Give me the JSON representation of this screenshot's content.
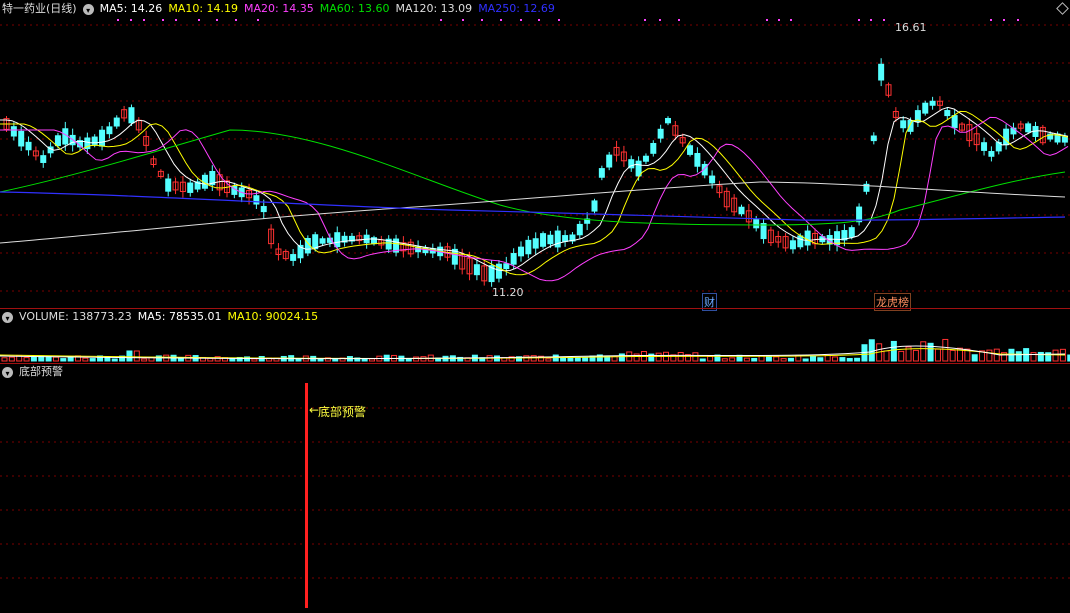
{
  "header": {
    "stock_name": "特一药业(日线)",
    "ma_items": [
      {
        "label": "MA5: 14.26",
        "color": "#ffffff"
      },
      {
        "label": "MA10: 14.19",
        "color": "#ffff00"
      },
      {
        "label": "MA20: 14.35",
        "color": "#ff40ff"
      },
      {
        "label": "MA60: 13.60",
        "color": "#00e000"
      },
      {
        "label": "MA120: 13.09",
        "color": "#dddddd"
      },
      {
        "label": "MA250: 12.69",
        "color": "#3030ff"
      }
    ]
  },
  "price_panel": {
    "high_label": "16.61",
    "low_label": "11.20",
    "marker_cai": "财",
    "marker_longhu": "龙虎榜"
  },
  "volume_panel": {
    "title": "VOLUME: 138773.23",
    "ma5": "MA5: 78535.01",
    "ma10": "MA10: 90024.15"
  },
  "indicator_panel": {
    "title": "底部预警",
    "signal_label": "底部预警"
  },
  "colors": {
    "up": "#ff3232",
    "down": "#54ffff",
    "grid": "#7a0000",
    "separator": "#a01010"
  }
}
